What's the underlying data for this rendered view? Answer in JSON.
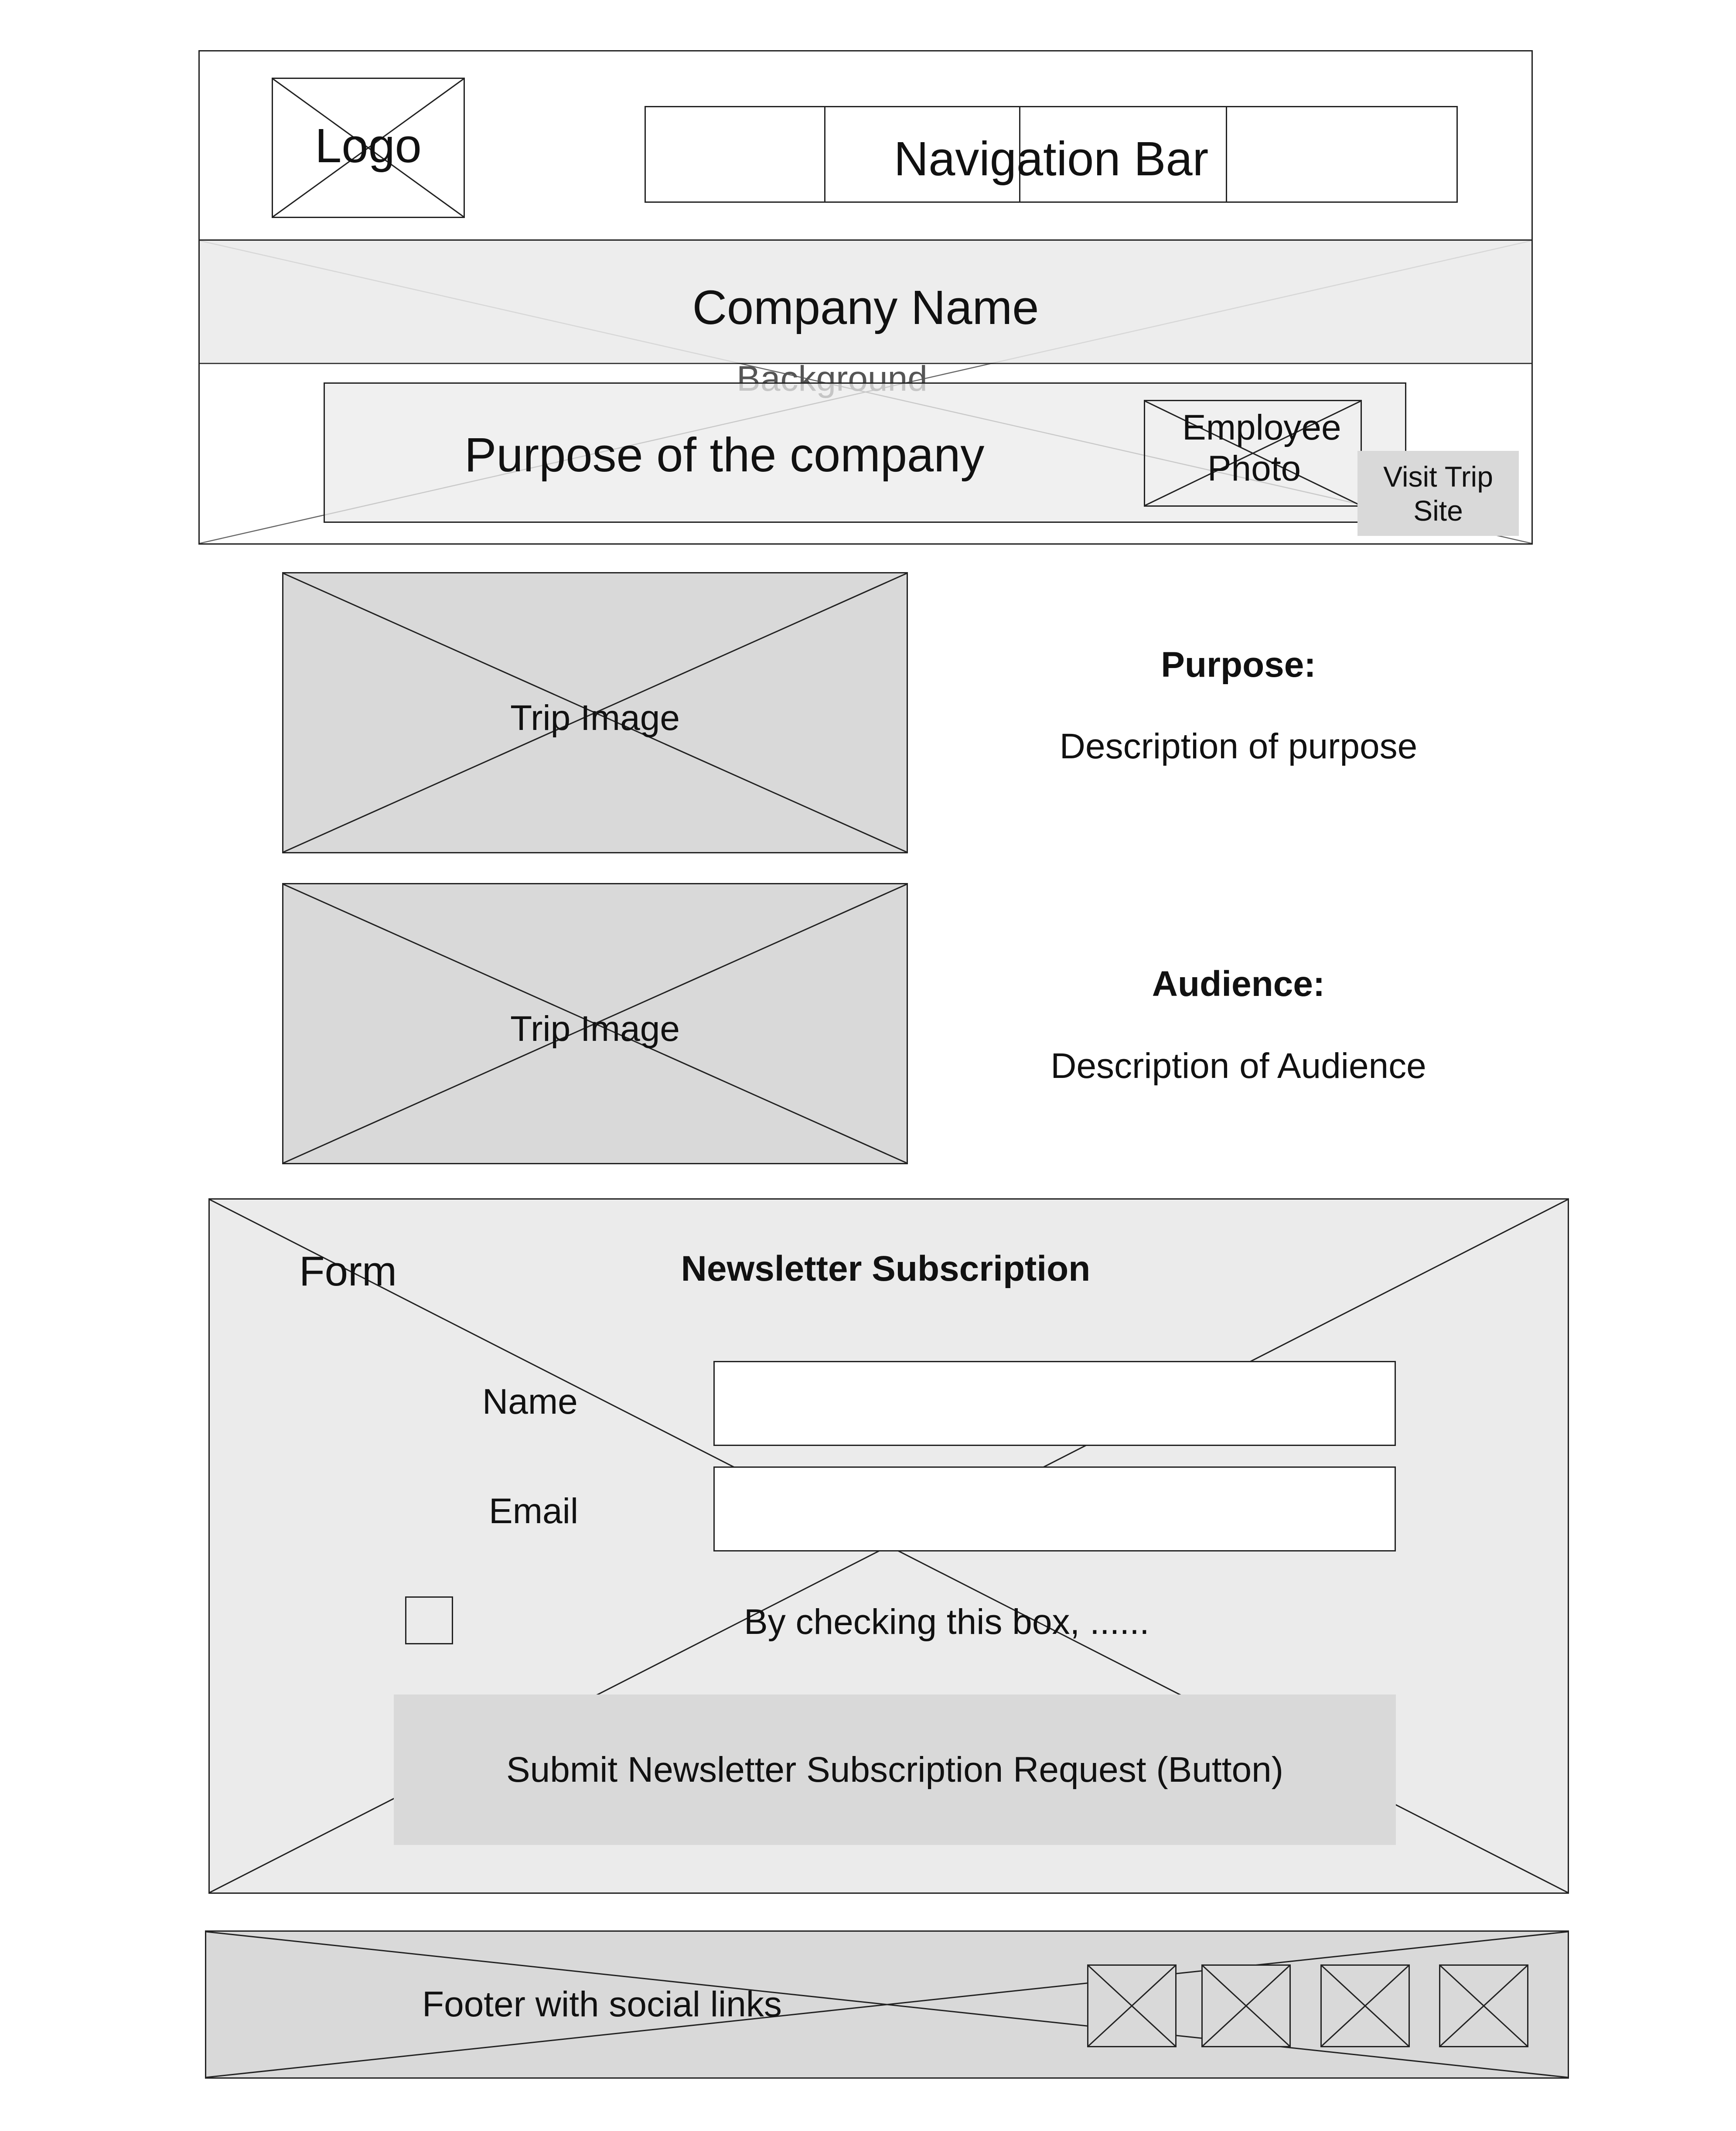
{
  "header": {
    "logo_label": "Logo",
    "nav_label": "Navigation Bar"
  },
  "hero": {
    "company_name": "Company Name",
    "background_label": "Background",
    "purpose_label": "Purpose of the company",
    "employee_photo_label": "Employee Photo",
    "visit_button_label": "Visit Trip Site"
  },
  "sections": [
    {
      "image_label": "Trip Image",
      "heading": "Purpose:",
      "description": "Description of purpose"
    },
    {
      "image_label": "Trip Image",
      "heading": "Audience:",
      "description": "Description of Audience"
    }
  ],
  "form": {
    "form_label": "Form",
    "title": "Newsletter Subscription",
    "name_label": "Name",
    "email_label": "Email",
    "checkbox_text": "By checking this box, ......",
    "submit_label": "Submit Newsletter Subscription Request (Button)"
  },
  "footer": {
    "label": "Footer with social links",
    "social_icons": [
      "social-icon",
      "social-icon",
      "social-icon",
      "social-icon"
    ]
  },
  "colors": {
    "line": "#222222",
    "panel_light": "#ebebeb",
    "panel_mid": "#d9d9d9",
    "background": "#ffffff"
  }
}
